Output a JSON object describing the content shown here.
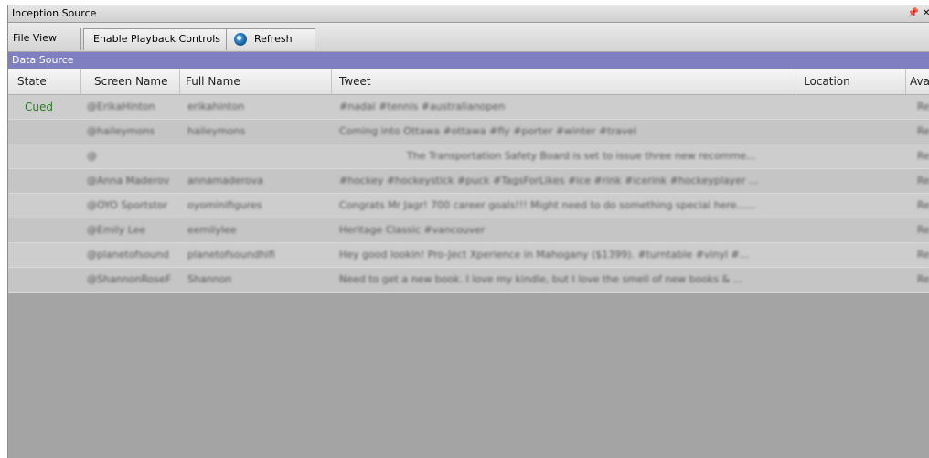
{
  "window": {
    "title": "Inception Source"
  },
  "toolbar": {
    "file_view": "File  View",
    "enable_playback": "Enable Playback Controls",
    "refresh": "Refresh"
  },
  "data_source_label": "Data Source",
  "columns": {
    "state": "State",
    "screen_name": "Screen Name",
    "full_name": "Full Name",
    "tweet": "Tweet",
    "location": "Location",
    "available": "Ava"
  },
  "rows": [
    {
      "state": "Cued",
      "screen_name": "@ErikaHinton",
      "full_name": "erikahinton",
      "tweet": "#nadal #tennis #australianopen",
      "available": "Re"
    },
    {
      "state": "",
      "screen_name": "@haileymons",
      "full_name": "haileymons",
      "tweet": "Coming into Ottawa #ottawa #fly #porter #winter #travel",
      "available": "Re"
    },
    {
      "state": "",
      "screen_name": "@",
      "full_name": "",
      "tweet": "The Transportation Safety Board is set to issue three new recomme...",
      "available": "Re"
    },
    {
      "state": "",
      "screen_name": "@Anna Maderov",
      "full_name": "annamaderova",
      "tweet": "#hockey #hockeystick #puck #TagsForLikes #ice #rink #icerink #hockeyplayer ...",
      "available": "Re"
    },
    {
      "state": "",
      "screen_name": "@OYO Sportstor",
      "full_name": "oyominifigures",
      "tweet": "Congrats Mr Jagr! 700 career goals!!! Might need to do something special here......",
      "available": "Re"
    },
    {
      "state": "",
      "screen_name": "@Emily Lee",
      "full_name": "eemilylee",
      "tweet": "Heritage Classic #vancouver",
      "available": "Re"
    },
    {
      "state": "",
      "screen_name": "@planetofsound",
      "full_name": "planetofsoundhifi",
      "tweet": "Hey good lookin! Pro-Ject Xperience in Mahogany ($1399). #turntable #vinyl #...",
      "available": "Re"
    },
    {
      "state": "",
      "screen_name": "@ShannonRoseF",
      "full_name": "Shannon",
      "tweet": "Need to get a new book. I love my kindle, but I love the smell of new books & ...",
      "available": "Re"
    }
  ]
}
